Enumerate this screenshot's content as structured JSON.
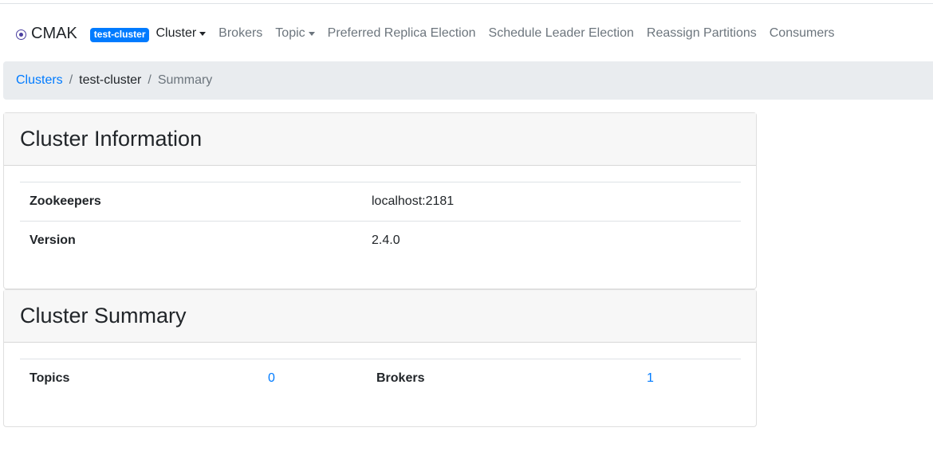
{
  "nav": {
    "brand": "CMAK",
    "cluster_badge": "test-cluster",
    "items": [
      {
        "label": "Cluster",
        "dropdown": true,
        "active": true
      },
      {
        "label": "Brokers",
        "dropdown": false
      },
      {
        "label": "Topic",
        "dropdown": true
      },
      {
        "label": "Preferred Replica Election",
        "dropdown": false
      },
      {
        "label": "Schedule Leader Election",
        "dropdown": false
      },
      {
        "label": "Reassign Partitions",
        "dropdown": false
      },
      {
        "label": "Consumers",
        "dropdown": false
      }
    ]
  },
  "breadcrumb": {
    "clusters": "Clusters",
    "cluster": "test-cluster",
    "current": "Summary",
    "separator": "/"
  },
  "cluster_information": {
    "title": "Cluster Information",
    "rows": [
      {
        "label": "Zookeepers",
        "value": "localhost:2181"
      },
      {
        "label": "Version",
        "value": "2.4.0"
      }
    ]
  },
  "cluster_summary": {
    "title": "Cluster Summary",
    "topics_label": "Topics",
    "topics_value": "0",
    "brokers_label": "Brokers",
    "brokers_value": "1"
  },
  "colors": {
    "link": "#007bff",
    "badge": "#007bff",
    "nav_muted": "#6c757d",
    "breadcrumb_bg": "#e9ecef",
    "card_header_bg": "#f7f7f7"
  }
}
